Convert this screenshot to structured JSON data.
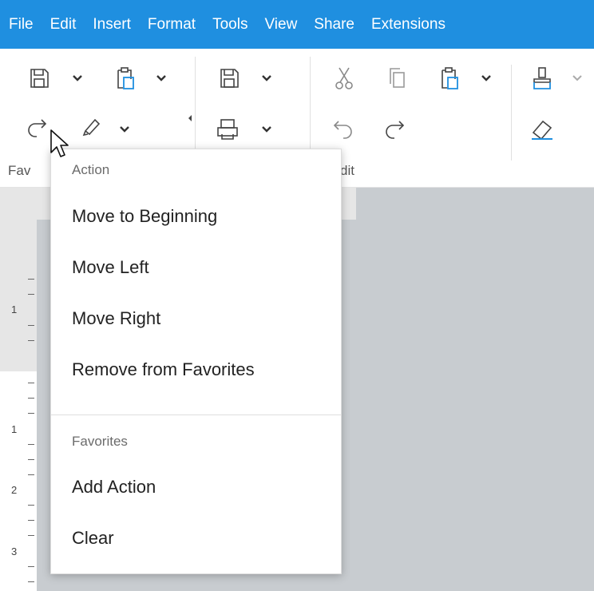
{
  "menubar": {
    "items": [
      {
        "label": "File"
      },
      {
        "label": "Edit"
      },
      {
        "label": "Insert"
      },
      {
        "label": "Format"
      },
      {
        "label": "Tools"
      },
      {
        "label": "View"
      },
      {
        "label": "Share"
      },
      {
        "label": "Extensions"
      }
    ]
  },
  "toolbar": {
    "favorites_label": "Fav",
    "edit_label": "dit",
    "icons": {
      "row1": [
        "save-icon",
        "paste-icon",
        "save-icon",
        "cut-icon",
        "copy-icon",
        "paste-icon",
        "format-painter-icon"
      ],
      "row2": [
        "redo-icon",
        "highlighter-icon",
        "print-icon",
        "undo-icon",
        "redo-icon",
        "eraser-icon"
      ]
    }
  },
  "ruler": {
    "numbers": [
      "1",
      "1",
      "2",
      "3"
    ]
  },
  "popup": {
    "action_title": "Action",
    "action_items": [
      {
        "label": "Move to Beginning"
      },
      {
        "label": "Move Left"
      },
      {
        "label": "Move Right"
      },
      {
        "label": "Remove from Favorites"
      }
    ],
    "favorites_title": "Favorites",
    "favorites_items": [
      {
        "label": "Add Action"
      },
      {
        "label": "Clear"
      }
    ]
  },
  "colors": {
    "menubar_bg": "#1f8fe0",
    "doc_bg": "#c8ccd0",
    "icon_stroke": "#444444",
    "icon_accent": "#1f8fe0"
  }
}
